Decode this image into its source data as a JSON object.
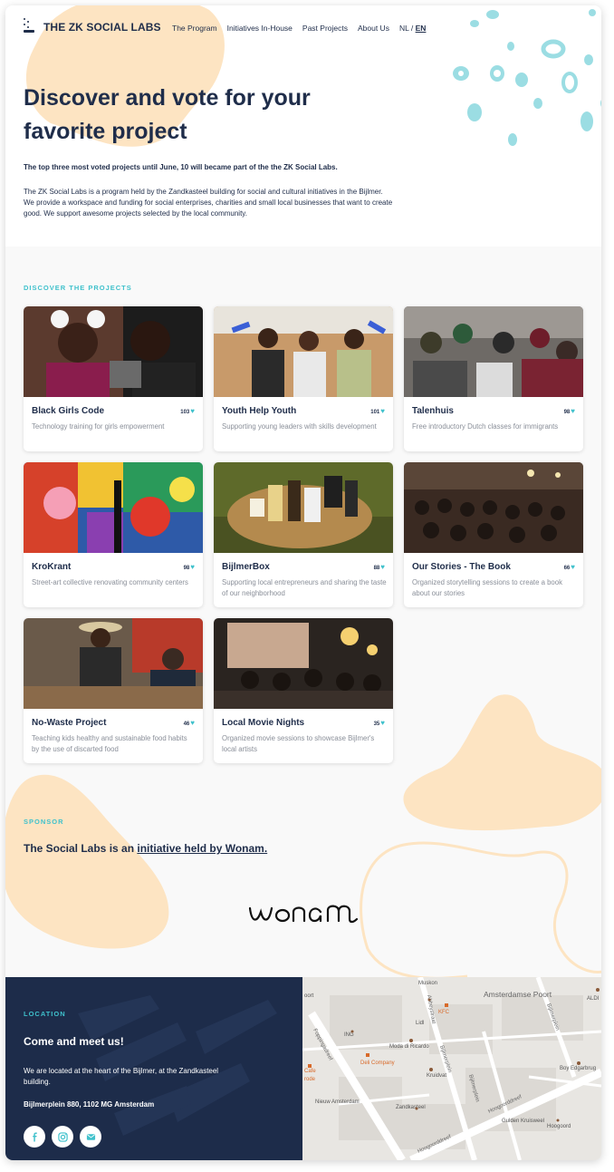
{
  "header": {
    "logo_text": "THE ZK SOCIAL LABS",
    "nav": [
      "The Program",
      "Initiatives In-House",
      "Past Projects",
      "About Us"
    ],
    "lang_nl": "NL /",
    "lang_en": "EN"
  },
  "hero": {
    "title": "Discover and vote for your favorite project",
    "lead": "The top three most voted projects until June, 10 will became part of the the ZK Social Labs.",
    "body": "The ZK Social Labs is a program held by the Zandkasteel building for social and cultural initiatives in the Bijlmer. We provide a workspace and funding for social enterprises, charities and small local businesses that want to create good.  We support awesome projects selected by the local community."
  },
  "projects": {
    "label": "DISCOVER THE PROJECTS",
    "items": [
      {
        "title": "Black Girls Code",
        "votes": "103",
        "desc": "Technology training for girls empowerment"
      },
      {
        "title": "Youth Help Youth",
        "votes": "101",
        "desc": "Supporting young leaders with skills development"
      },
      {
        "title": "Talenhuis",
        "votes": "98",
        "desc": "Free introductory Dutch classes  for immigrants"
      },
      {
        "title": "KroKrant",
        "votes": "98",
        "desc": "Street-art collective renovating community centers"
      },
      {
        "title": "BijlmerBox",
        "votes": "88",
        "desc": "Supporting local entrepreneurs and sharing the taste of our neighborhood"
      },
      {
        "title": "Our Stories - The Book",
        "votes": "66",
        "desc": "Organized storytelling sessions to create a book about our stories"
      },
      {
        "title": "No-Waste Project",
        "votes": "46",
        "desc": "Teaching kids healthy and sustainable food habits by the use of discarted food"
      },
      {
        "title": "Local Movie Nights",
        "votes": "35",
        "desc": "Organized movie sessions to showcase Bijlmer's local artists"
      }
    ]
  },
  "sponsor": {
    "label": "SPONSOR",
    "text_prefix": "The Social Labs is an ",
    "link_text": "initiative held by Wonam.",
    "logo_text": "wonam"
  },
  "location": {
    "label": "LOCATION",
    "title": "Come and meet us!",
    "body": "We are located at the heart of the Bijlmer, at the Zandkasteel building.",
    "address": "Bijlmerplein 880, 1102 MG Amsterdam"
  },
  "map": {
    "labels": {
      "muskon": "Muskon",
      "amsterdamse_poort": "Amsterdamse Poort",
      "aldi": "ALDI",
      "ing": "ING",
      "kfc": "KFC",
      "lidl": "Lidl",
      "moda": "Moda di Ricardo",
      "deli": "Deli Company",
      "kruidvat": "Kruidvat",
      "boy": "Boy Edgarbrug",
      "cafe": "Cafe",
      "roda": "rode",
      "nieuw": "Nieuw Amsterdam",
      "zandkasteel": "Zandkasteel",
      "guiden": "Gulden Kruisweel",
      "hoogoord": "Hoogoord",
      "foppingadreef": "Foppingadreef",
      "hoogoorddreef": "Hoogoorddreef",
      "bijlmerdreef": "Bijlmerplein",
      "hoogoorddreef2": "Hoogoorddreef",
      "abbey": "Abbeystraat",
      "bijlmerplein2": "Bijlmerplein",
      "arena": "Bijlmerplein",
      "port": "oort"
    }
  }
}
